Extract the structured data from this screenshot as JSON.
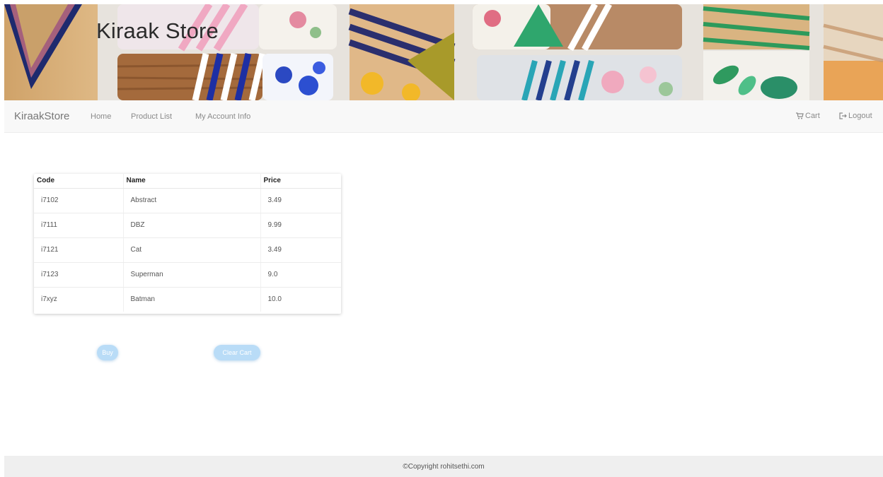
{
  "banner": {
    "title": "Kiraak Store"
  },
  "navbar": {
    "brand": "KiraakStore",
    "links": [
      "Home",
      "Product List",
      "My Account Info"
    ],
    "cart": {
      "label": "Cart",
      "icon": "cart-icon"
    },
    "logout": {
      "label": "Logout",
      "icon": "logout-icon"
    }
  },
  "cart_table": {
    "headers": [
      "Code",
      "Name",
      "Price"
    ],
    "rows": [
      [
        "i7102",
        "Abstract",
        "3.49"
      ],
      [
        "i7111",
        "DBZ",
        "9.99"
      ],
      [
        "i7121",
        "Cat",
        "3.49"
      ],
      [
        "i7123",
        "Superman",
        "9.0"
      ],
      [
        "i7xyz",
        "Batman",
        "10.0"
      ]
    ]
  },
  "actions": {
    "buy": "Buy",
    "clear_cart": "Clear Cart"
  },
  "footer": {
    "text": "©Copyright rohitsethi.com"
  },
  "colors": {
    "button": "#b9dcf7",
    "navbar": "#f8f8f8",
    "footer": "#efefef"
  }
}
